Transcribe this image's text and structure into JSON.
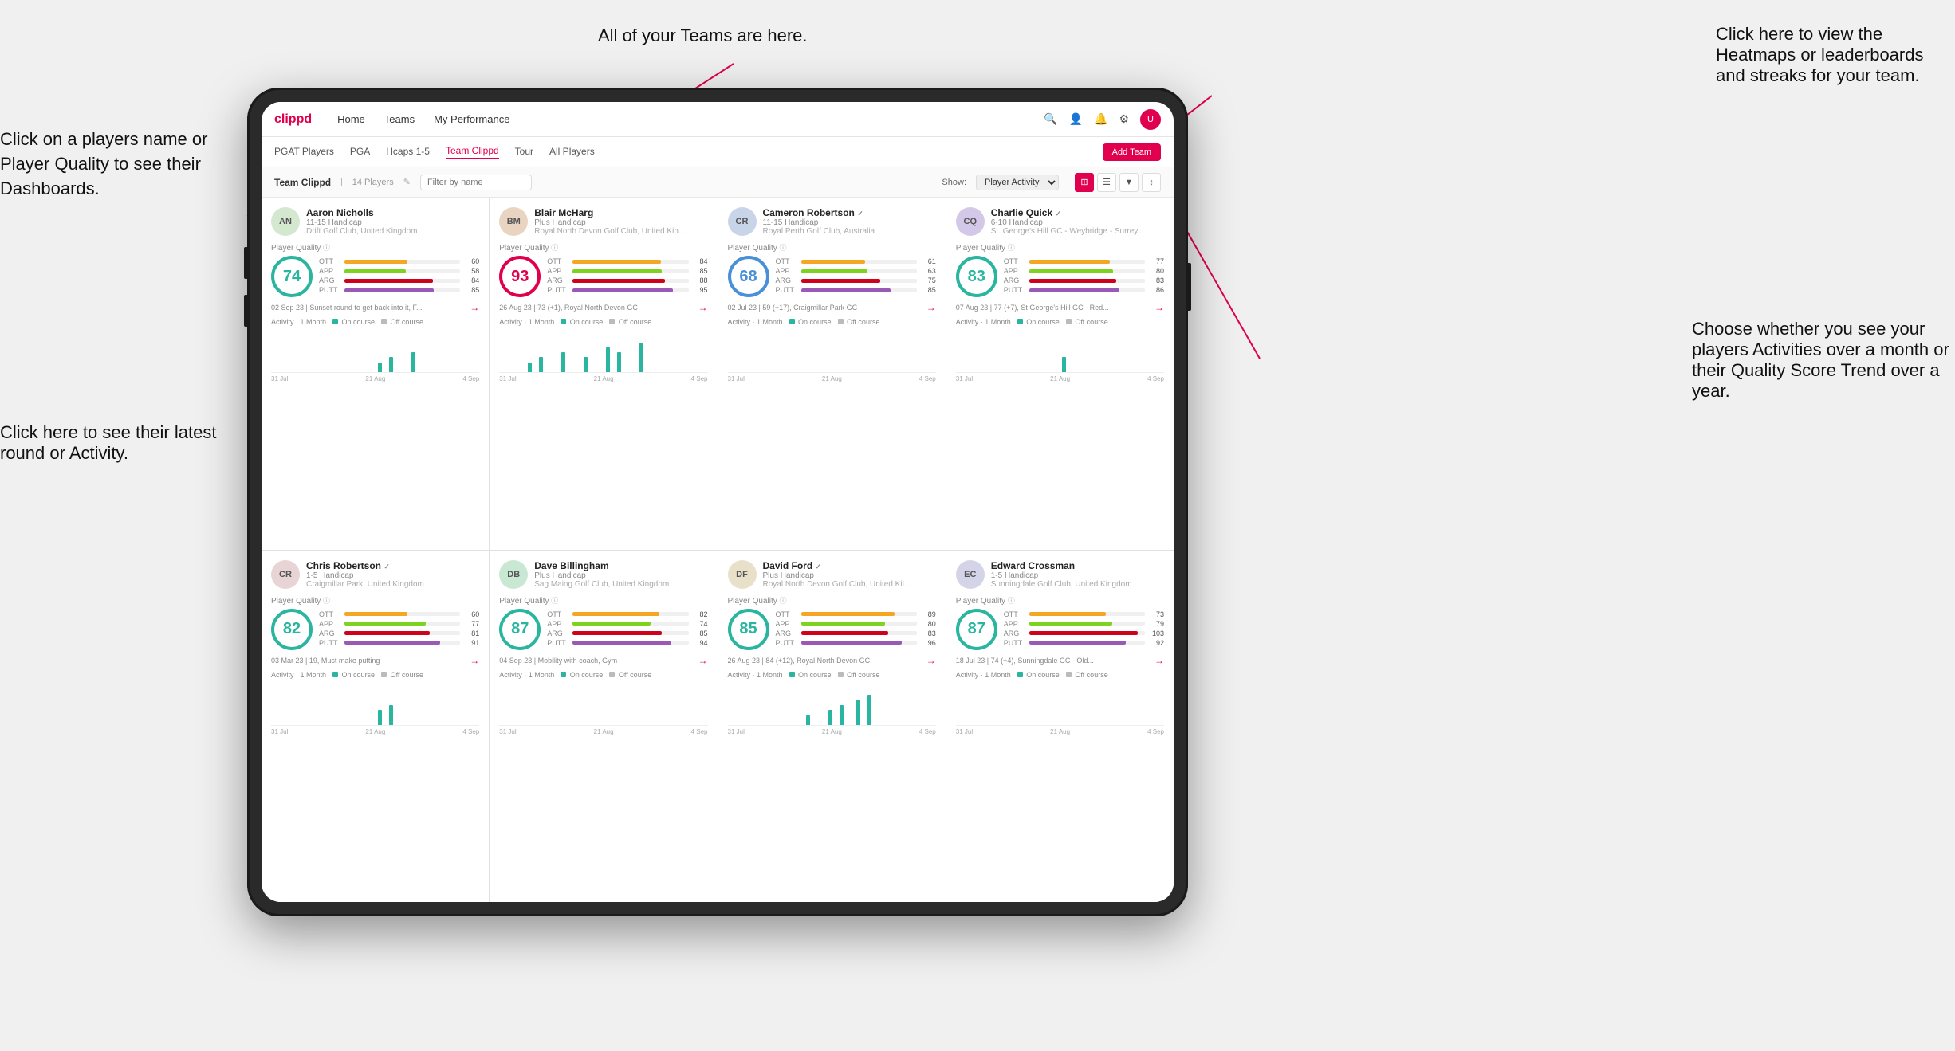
{
  "annotations": {
    "click_players": "Click on a players name\nor Player Quality to see\ntheir Dashboards.",
    "teams_here": "All of your Teams are here.",
    "heatmaps": "Click here to view the\nHeatmaps or leaderboards\nand streaks for your team.",
    "latest_round": "Click here to see their latest\nround or Activity.",
    "activities": "Choose whether you see\nyour players Activities over\na month or their Quality\nScore Trend over a year."
  },
  "nav": {
    "logo": "clippd",
    "items": [
      "Home",
      "Teams",
      "My Performance"
    ],
    "subnav": [
      "PGAT Players",
      "PGA",
      "Hcaps 1-5",
      "Team Clippd",
      "Tour",
      "All Players"
    ],
    "active_subnav": "Team Clippd",
    "add_team": "Add Team"
  },
  "team_header": {
    "title": "Team Clippd",
    "count": "14 Players",
    "filter_placeholder": "Filter by name",
    "show_label": "Show:",
    "show_value": "Player Activity"
  },
  "players": [
    {
      "name": "Aaron Nicholls",
      "handicap": "11-15 Handicap",
      "club": "Drift Golf Club, United Kingdom",
      "quality": 74,
      "quality_color": "teal",
      "ott": 60,
      "app": 58,
      "arg": 84,
      "putt": 85,
      "latest_round": "02 Sep 23 | Sunset round to get back into it, F...",
      "avatar_bg": "#d4e8d0",
      "avatar_initials": "AN",
      "chart_bars": [
        0,
        0,
        0,
        0,
        0,
        0,
        0,
        0,
        0,
        0,
        0,
        0,
        0,
        0,
        0,
        0,
        0,
        0,
        0,
        2,
        0,
        3,
        0,
        0,
        0,
        4,
        0,
        0,
        0,
        0
      ],
      "chart_labels": [
        "31 Jul",
        "21 Aug",
        "4 Sep"
      ]
    },
    {
      "name": "Blair McHarg",
      "handicap": "Plus Handicap",
      "club": "Royal North Devon Golf Club, United Kin...",
      "quality": 93,
      "quality_color": "red",
      "ott": 84,
      "app": 85,
      "arg": 88,
      "putt": 95,
      "latest_round": "26 Aug 23 | 73 (+1), Royal North Devon GC",
      "avatar_bg": "#e8d4c0",
      "avatar_initials": "BM",
      "chart_bars": [
        0,
        0,
        0,
        0,
        0,
        2,
        0,
        3,
        0,
        0,
        0,
        4,
        0,
        0,
        0,
        3,
        0,
        0,
        0,
        5,
        0,
        4,
        0,
        0,
        0,
        6,
        0,
        0,
        0,
        0
      ],
      "chart_labels": [
        "31 Jul",
        "21 Aug",
        "4 Sep"
      ]
    },
    {
      "name": "Cameron Robertson",
      "handicap": "11-15 Handicap",
      "club": "Royal Perth Golf Club, Australia",
      "quality": 68,
      "quality_color": "blue",
      "ott": 61,
      "app": 63,
      "arg": 75,
      "putt": 85,
      "latest_round": "02 Jul 23 | 59 (+17), Craigmillar Park GC",
      "avatar_bg": "#c8d4e8",
      "avatar_initials": "CR",
      "chart_bars": [
        0,
        0,
        0,
        0,
        0,
        0,
        0,
        0,
        0,
        0,
        0,
        0,
        0,
        0,
        0,
        0,
        0,
        0,
        0,
        0,
        0,
        0,
        0,
        0,
        0,
        0,
        0,
        0,
        0,
        0
      ],
      "chart_labels": [
        "31 Jul",
        "21 Aug",
        "4 Sep"
      ]
    },
    {
      "name": "Charlie Quick",
      "handicap": "6-10 Handicap",
      "club": "St. George's Hill GC - Weybridge - Surrey...",
      "quality": 83,
      "quality_color": "teal",
      "ott": 77,
      "app": 80,
      "arg": 83,
      "putt": 86,
      "latest_round": "07 Aug 23 | 77 (+7), St George's Hill GC - Red...",
      "avatar_bg": "#d4c8e8",
      "avatar_initials": "CQ",
      "chart_bars": [
        0,
        0,
        0,
        0,
        0,
        0,
        0,
        0,
        0,
        0,
        0,
        0,
        0,
        0,
        0,
        0,
        0,
        0,
        0,
        3,
        0,
        0,
        0,
        0,
        0,
        0,
        0,
        0,
        0,
        0
      ],
      "chart_labels": [
        "31 Jul",
        "21 Aug",
        "4 Sep"
      ]
    },
    {
      "name": "Chris Robertson",
      "handicap": "1-5 Handicap",
      "club": "Craigmillar Park, United Kingdom",
      "quality": 82,
      "quality_color": "teal",
      "ott": 60,
      "app": 77,
      "arg": 81,
      "putt": 91,
      "latest_round": "03 Mar 23 | 19, Must make putting",
      "avatar_bg": "#e8d4d4",
      "avatar_initials": "CR",
      "chart_bars": [
        0,
        0,
        0,
        0,
        0,
        0,
        0,
        0,
        0,
        0,
        0,
        0,
        0,
        0,
        0,
        0,
        0,
        0,
        0,
        3,
        0,
        4,
        0,
        0,
        0,
        0,
        0,
        0,
        0,
        0
      ],
      "chart_labels": [
        "31 Jul",
        "21 Aug",
        "4 Sep"
      ]
    },
    {
      "name": "Dave Billingham",
      "handicap": "Plus Handicap",
      "club": "Sag Maing Golf Club, United Kingdom",
      "quality": 87,
      "quality_color": "teal",
      "ott": 82,
      "app": 74,
      "arg": 85,
      "putt": 94,
      "latest_round": "04 Sep 23 | Mobility with coach, Gym",
      "avatar_bg": "#c8e8d4",
      "avatar_initials": "DB",
      "chart_bars": [
        0,
        0,
        0,
        0,
        0,
        0,
        0,
        0,
        0,
        0,
        0,
        0,
        0,
        0,
        0,
        0,
        0,
        0,
        0,
        0,
        0,
        0,
        0,
        0,
        0,
        0,
        0,
        0,
        0,
        0
      ],
      "chart_labels": [
        "31 Jul",
        "21 Aug",
        "4 Sep"
      ]
    },
    {
      "name": "David Ford",
      "handicap": "Plus Handicap",
      "club": "Royal North Devon Golf Club, United Kil...",
      "quality": 85,
      "quality_color": "teal",
      "ott": 89,
      "app": 80,
      "arg": 83,
      "putt": 96,
      "latest_round": "26 Aug 23 | 84 (+12), Royal North Devon GC",
      "avatar_bg": "#e8e0c8",
      "avatar_initials": "DF",
      "chart_bars": [
        0,
        0,
        0,
        0,
        0,
        0,
        0,
        0,
        0,
        0,
        0,
        0,
        0,
        0,
        2,
        0,
        0,
        0,
        3,
        0,
        4,
        0,
        0,
        5,
        0,
        6,
        0,
        0,
        0,
        0
      ],
      "chart_labels": [
        "31 Jul",
        "21 Aug",
        "4 Sep"
      ]
    },
    {
      "name": "Edward Crossman",
      "handicap": "1-5 Handicap",
      "club": "Sunningdale Golf Club, United Kingdom",
      "quality": 87,
      "quality_color": "teal",
      "ott": 73,
      "app": 79,
      "arg": 103,
      "putt": 92,
      "latest_round": "18 Jul 23 | 74 (+4), Sunningdale GC - Old...",
      "avatar_bg": "#d4d4e8",
      "avatar_initials": "EC",
      "chart_bars": [
        0,
        0,
        0,
        0,
        0,
        0,
        0,
        0,
        0,
        0,
        0,
        0,
        0,
        0,
        0,
        0,
        0,
        0,
        0,
        0,
        0,
        0,
        0,
        0,
        0,
        0,
        0,
        0,
        0,
        0
      ],
      "chart_labels": [
        "31 Jul",
        "21 Aug",
        "4 Sep"
      ]
    }
  ],
  "activity": {
    "label": "Activity · 1 Month",
    "on_course": "On course",
    "off_course": "Off course"
  },
  "colors": {
    "accent": "#e0004d",
    "teal": "#2ab5a0",
    "blue": "#4a90d9",
    "bar_ott": "#f5a623",
    "bar_app": "#7ed321",
    "bar_arg": "#d0021b",
    "bar_putt": "#9b59b6"
  }
}
